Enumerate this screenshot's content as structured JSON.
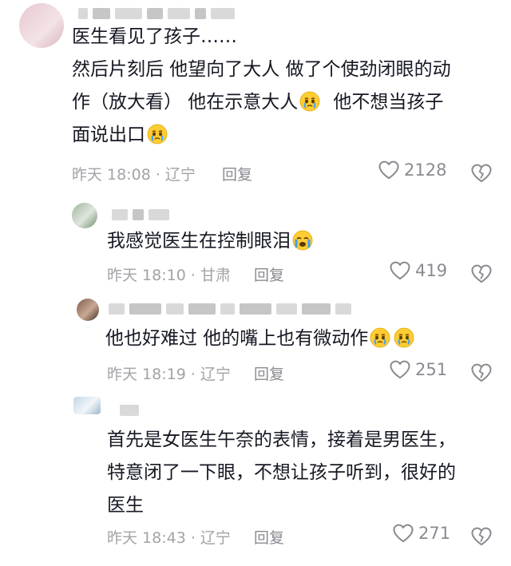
{
  "comments": [
    {
      "lines": [
        "医生看见了孩子……",
        "然后片刻后 他望向了大人 做了个使劲闭眼的动",
        "作（放大看） 他在示意大人",
        "面说出口"
      ],
      "time": "昨天 18:08 · 辽宁",
      "reply": "回复",
      "likes": "2128",
      "emoji_after_line2": "crying-face-emoji",
      "line2_tail": "他不想当孩子"
    },
    {
      "text": "我感觉医生在控制眼泪",
      "time": "昨天 18:10 · 甘肃",
      "reply": "回复",
      "likes": "419",
      "emoji": "loudly-crying-emoji"
    },
    {
      "text": "他也好难过 他的嘴上也有微动作",
      "time": "昨天 18:19 · 辽宁",
      "reply": "回复",
      "likes": "251",
      "emoji": "crying-face-emoji"
    },
    {
      "lines": [
        "首先是女医生午奈的表情，接着是男医生，",
        "特意闭了一下眼，不想让孩子听到，很好的",
        "医生"
      ],
      "time": "昨天 18:43 · 辽宁",
      "reply": "回复",
      "likes": "271"
    }
  ],
  "colors": {
    "text": "#161823",
    "meta": "#a3a3a8",
    "icon": "#8a8b91"
  }
}
